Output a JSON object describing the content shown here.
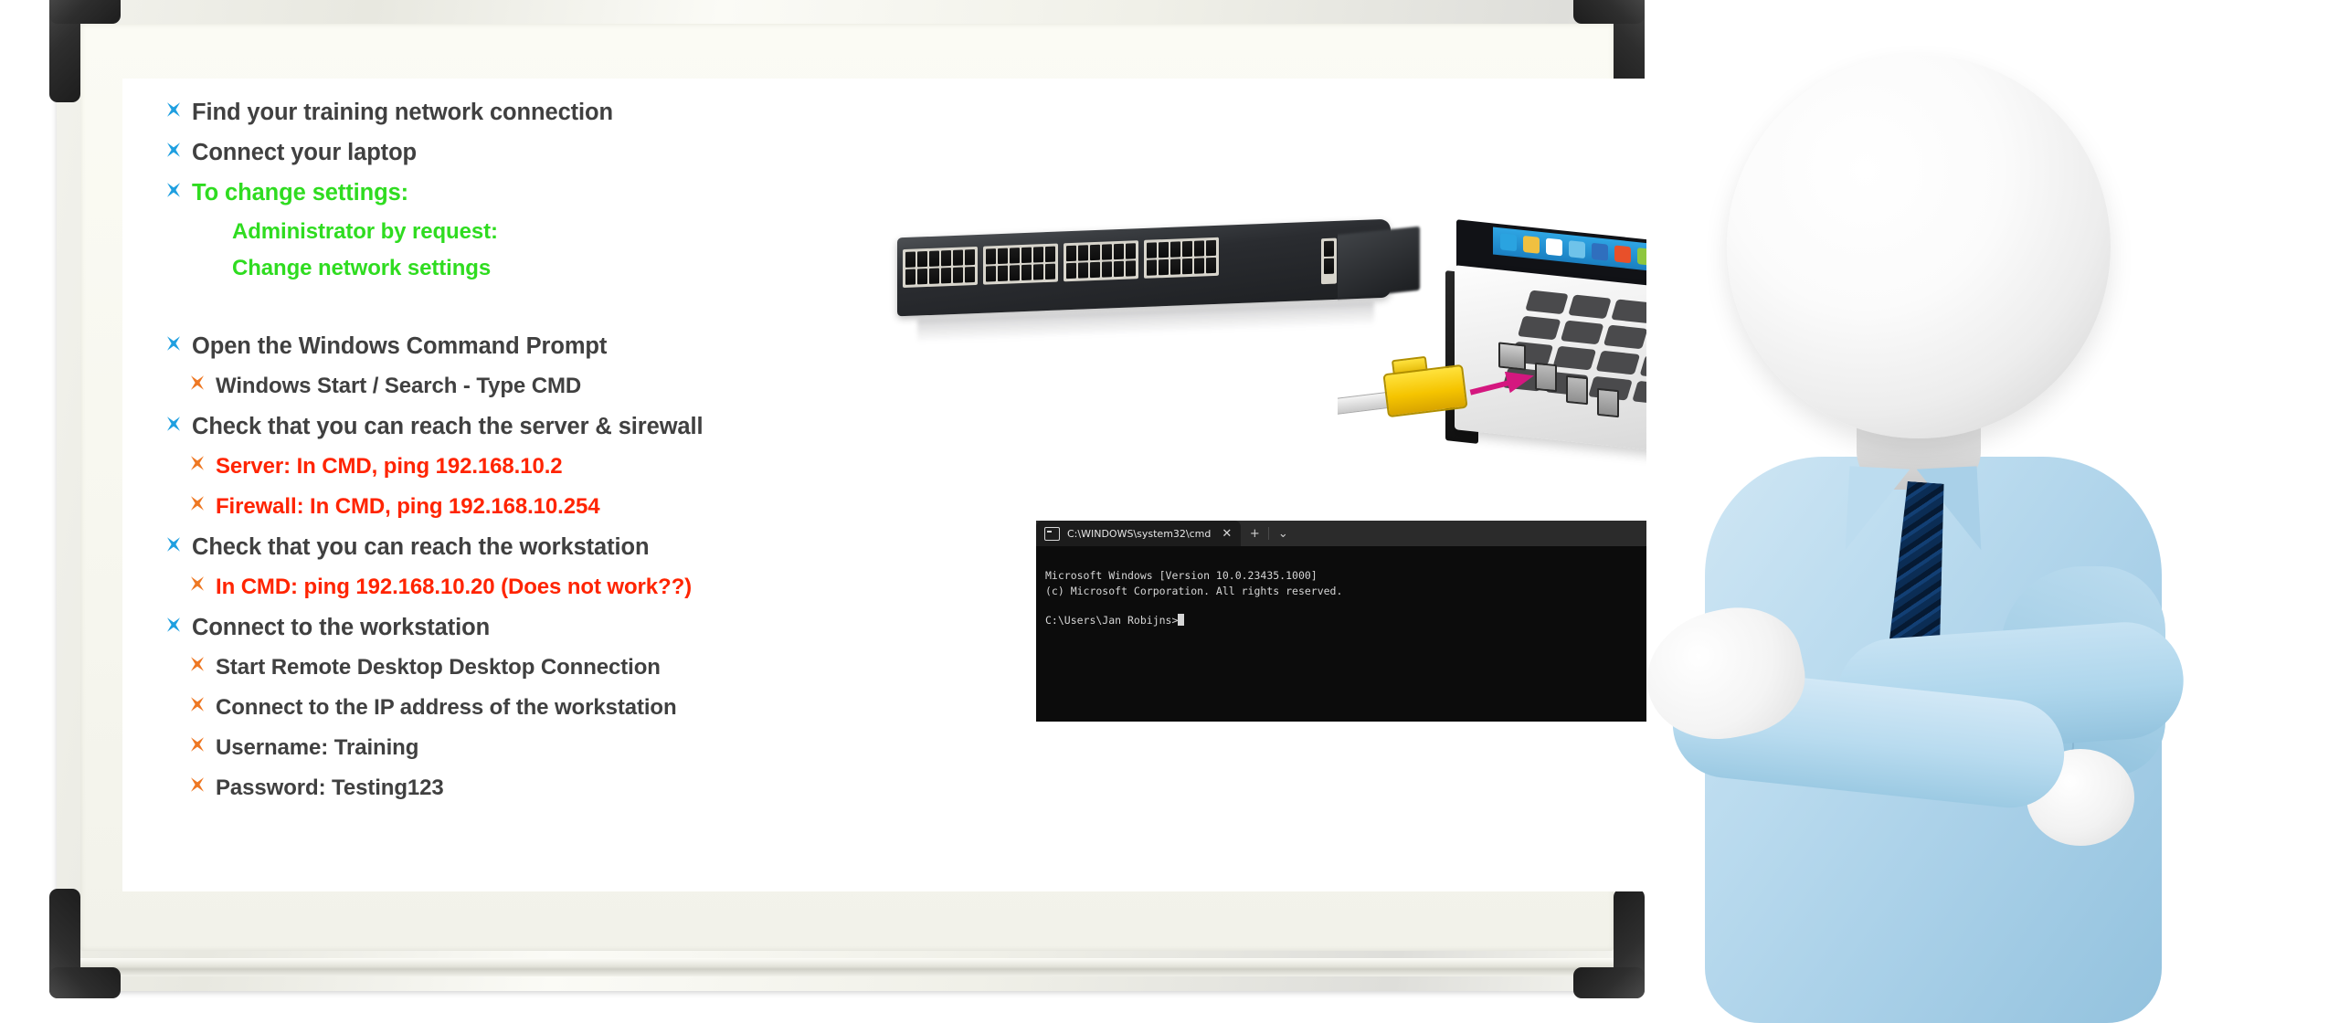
{
  "slide": {
    "bullets": [
      {
        "level": 1,
        "mark": "x-mark-blue",
        "text": "Find your training network connection",
        "color": "dark"
      },
      {
        "level": 1,
        "mark": "x-mark-blue",
        "text": "Connect your laptop",
        "color": "dark"
      },
      {
        "level": 1,
        "mark": "x-mark-blue",
        "text": "To change settings:",
        "color": "green"
      },
      {
        "level": 0,
        "mark": "none",
        "text": "Administrator by request:",
        "color": "green"
      },
      {
        "level": 0,
        "mark": "none",
        "text": "Change network settings",
        "color": "green"
      },
      {
        "level": 1,
        "mark": "x-mark-blue",
        "text": "Open the Windows Command Prompt",
        "color": "dark"
      },
      {
        "level": 2,
        "mark": "x-mark-orange",
        "text": "Windows Start / Search - Type CMD",
        "color": "dark"
      },
      {
        "level": 1,
        "mark": "x-mark-blue",
        "text": "Check that you can reach the server & sirewall",
        "color": "dark"
      },
      {
        "level": 2,
        "mark": "x-mark-orange",
        "text": "Server: In CMD, ping 192.168.10.2",
        "color": "red"
      },
      {
        "level": 2,
        "mark": "x-mark-orange",
        "text": "Firewall: In CMD, ping 192.168.10.254",
        "color": "red"
      },
      {
        "level": 1,
        "mark": "x-mark-blue",
        "text": "Check that you can reach the workstation",
        "color": "dark"
      },
      {
        "level": 2,
        "mark": "x-mark-orange",
        "text": "In CMD: ping 192.168.10.20 (Does not work??)",
        "color": "red"
      },
      {
        "level": 1,
        "mark": "x-mark-blue",
        "text": "Connect to the workstation",
        "color": "dark"
      },
      {
        "level": 2,
        "mark": "x-mark-orange",
        "text": "Start Remote Desktop Desktop Connection",
        "color": "dark"
      },
      {
        "level": 2,
        "mark": "x-mark-orange",
        "text": "Connect to the IP address of the workstation",
        "color": "dark"
      },
      {
        "level": 2,
        "mark": "x-mark-orange",
        "text": "Username: Training",
        "color": "dark"
      },
      {
        "level": 2,
        "mark": "x-mark-orange",
        "text": "Password: Testing123",
        "color": "dark"
      }
    ]
  },
  "command_prompt": {
    "tab_title": "C:\\WINDOWS\\system32\\cmd",
    "close_label": "✕",
    "new_tab_label": "+",
    "dropdown_label": "⌄",
    "line1": "Microsoft Windows [Version 10.0.23435.1000]",
    "line2": "(c) Microsoft Corporation. All rights reserved.",
    "line3": "",
    "prompt": "C:\\Users\\Jan Robijns>"
  },
  "images": {
    "switch_alt": "rack-mount network switch",
    "laptop_alt": "laptop with yellow ethernet cable being connected",
    "character_alt": "3d white character in blue shirt with arms crossed"
  },
  "colors": {
    "bullet_blue": "#1e9fe0",
    "bullet_orange": "#ee7722",
    "text_dark": "#404040",
    "text_green": "#2fdc20",
    "text_red": "#ff2400",
    "board_frame": "#ecece4",
    "board_corner": "#2e2e2e",
    "cmd_background": "#0c0c0c",
    "cmd_titlebar": "#2b2b2b",
    "shirt_blue": "#aed6ec",
    "tie_navy": "#0b2d55",
    "cable_yellow": "#f5c400",
    "arrow_magenta": "#d4177f"
  }
}
